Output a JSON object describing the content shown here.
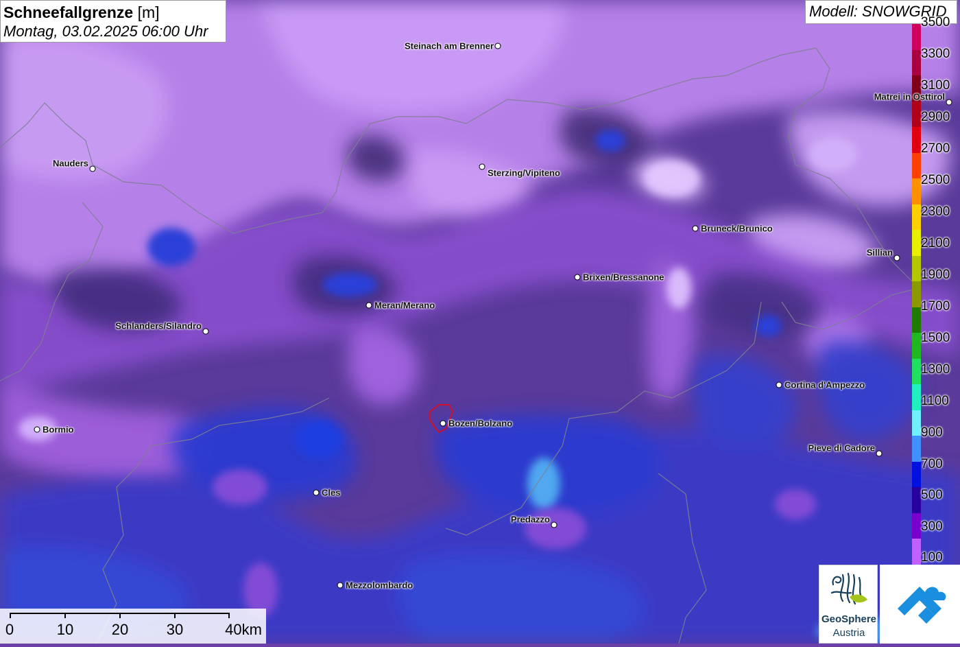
{
  "title": {
    "parameter": "Schneefallgrenze",
    "unit": "[m]",
    "datetime": "Montag, 03.02.2025 06:00 Uhr"
  },
  "model": "Modell: SNOWGRID",
  "legend": {
    "labels": [
      "3500",
      "3300",
      "3100",
      "2900",
      "2700",
      "2500",
      "2300",
      "2100",
      "1900",
      "1700",
      "1500",
      "1300",
      "1100",
      "900",
      "700",
      "500",
      "300",
      "100"
    ],
    "colors": [
      "#d0005f",
      "#a80040",
      "#80001a",
      "#b0001a",
      "#e00010",
      "#ff4000",
      "#ff9000",
      "#ffd000",
      "#e8f000",
      "#b4c800",
      "#8a9a00",
      "#207a00",
      "#20b820",
      "#20e060",
      "#20f0c0",
      "#70f0ff",
      "#4090ff",
      "#0010e0",
      "#2800a0",
      "#7a00d0",
      "#c060ff"
    ]
  },
  "cities": [
    {
      "name": "Steinach am Brenner"
    },
    {
      "name": "Nauders"
    },
    {
      "name": "Sterzing/Vipiteno"
    },
    {
      "name": "Matrei in Osttirol"
    },
    {
      "name": "Bruneck/Brunico"
    },
    {
      "name": "Sillian"
    },
    {
      "name": "Brixen/Bressanone"
    },
    {
      "name": "Meran/Merano"
    },
    {
      "name": "Schlanders/Silandro"
    },
    {
      "name": "Cortina d'Ampezzo"
    },
    {
      "name": "Bormio"
    },
    {
      "name": "Bozen/Bolzano"
    },
    {
      "name": "Pieve di Cadore"
    },
    {
      "name": "Cles"
    },
    {
      "name": "Predazzo"
    },
    {
      "name": "Mezzolombardo"
    }
  ],
  "scale": {
    "labels": [
      "0",
      "10",
      "20",
      "30",
      "40km"
    ]
  },
  "logos": {
    "geosphere_line1": "GeoSphere",
    "geosphere_line2": "Austria"
  }
}
